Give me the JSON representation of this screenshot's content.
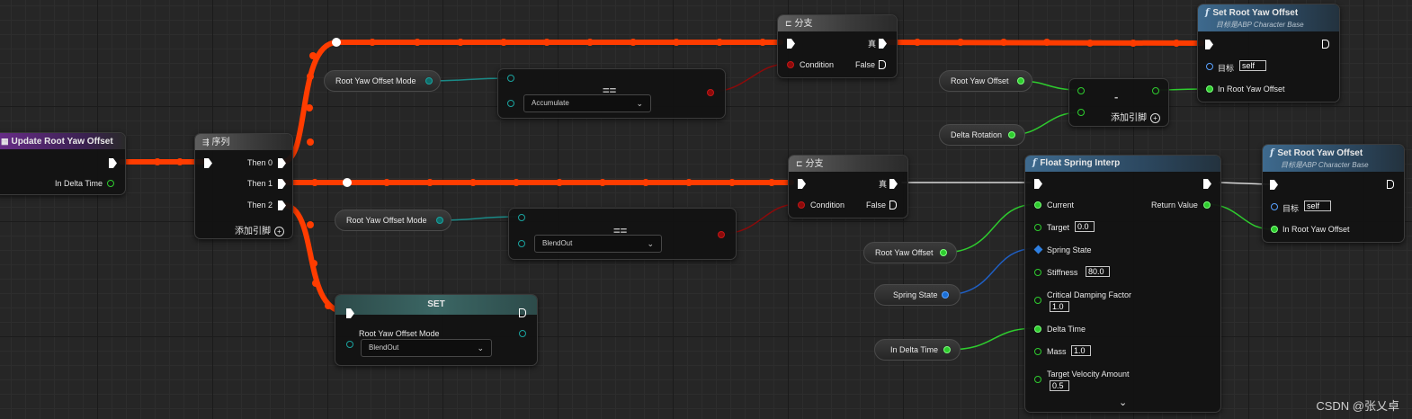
{
  "event_node": {
    "title": "Update Root Yaw Offset",
    "pin_delta_time": "In Delta Time"
  },
  "sequence_node": {
    "title": "序列",
    "then0": "Then 0",
    "then1": "Then 1",
    "then2": "Then 2",
    "add_pin": "添加引脚"
  },
  "branch_top": {
    "title": "分支",
    "condition": "Condition",
    "true_label": "真",
    "false_label": "False"
  },
  "branch_mid": {
    "title": "分支",
    "condition": "Condition",
    "true_label": "真",
    "false_label": "False"
  },
  "equal_top": {
    "op": "==",
    "selected": "Accumulate"
  },
  "equal_mid": {
    "op": "==",
    "selected": "BlendOut"
  },
  "var_mode_top": {
    "label": "Root Yaw Offset Mode"
  },
  "var_mode_mid": {
    "label": "Root Yaw Offset Mode"
  },
  "var_root_yaw_top": {
    "label": "Root Yaw Offset"
  },
  "var_delta_rotation": {
    "label": "Delta Rotation"
  },
  "var_root_yaw_mid": {
    "label": "Root Yaw Offset"
  },
  "var_spring_state": {
    "label": "Spring State"
  },
  "var_in_delta_time": {
    "label": "In Delta Time"
  },
  "subtract_node": {
    "op": "-",
    "add_pin": "添加引脚"
  },
  "set_root_yaw_top": {
    "title": "Set Root Yaw Offset",
    "subtitle": "目标是ABP Character Base",
    "target_label": "目标",
    "target_value": "self",
    "in_label": "In Root Yaw Offset"
  },
  "set_root_yaw_mid": {
    "title": "Set Root Yaw Offset",
    "subtitle": "目标是ABP Character Base",
    "target_label": "目标",
    "target_value": "self",
    "in_label": "In Root Yaw Offset"
  },
  "set_mode_node": {
    "title": "SET",
    "var_label": "Root Yaw Offset Mode",
    "selected": "BlendOut"
  },
  "spring_node": {
    "title": "Float Spring Interp",
    "current": "Current",
    "target": "Target",
    "target_value": "0.0",
    "spring_state": "Spring State",
    "stiffness": "Stiffness",
    "stiffness_value": "80.0",
    "damping": "Critical Damping Factor",
    "damping_value": "1.0",
    "delta_time": "Delta Time",
    "mass": "Mass",
    "mass_value": "1.0",
    "target_velocity": "Target Velocity Amount",
    "target_velocity_value": "0.5",
    "return_value": "Return Value"
  },
  "watermark": "CSDN @张乂卓",
  "colors": {
    "exec_wire": "#ff3c00",
    "float_pin": "#2ecc2e",
    "enum_pin": "#1aa39f",
    "bool_pin": "#c21818",
    "struct_pin": "#2e7fe0"
  }
}
